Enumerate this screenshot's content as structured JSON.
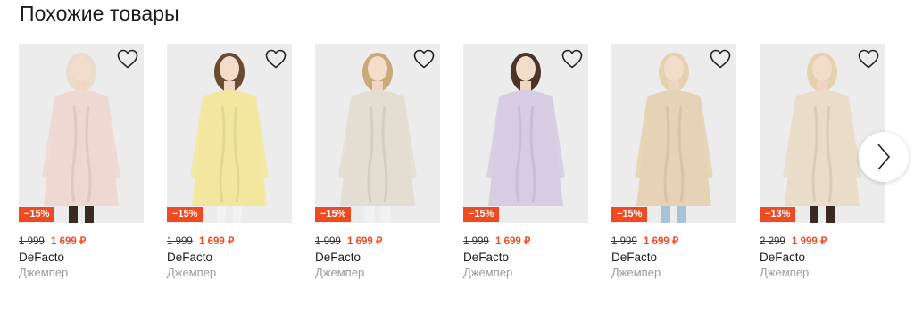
{
  "section": {
    "title": "Похожие товары"
  },
  "products": [
    {
      "brand": "DeFacto",
      "type": "Джемпер",
      "old_price": "1 999",
      "new_price": "1 699 ₽",
      "discount": "−15%",
      "sweater_color": "#efd8d2",
      "bg_color": "#ececec",
      "legs_color": "#3a2a22",
      "hair_color": "#e9dcc8"
    },
    {
      "brand": "DeFacto",
      "type": "Джемпер",
      "old_price": "1 999",
      "new_price": "1 699 ₽",
      "discount": "−15%",
      "sweater_color": "#f3e7a0",
      "bg_color": "#ececec",
      "legs_color": "#f2f2f2",
      "hair_color": "#6b4a32"
    },
    {
      "brand": "DeFacto",
      "type": "Джемпер",
      "old_price": "1 999",
      "new_price": "1 699 ₽",
      "discount": "−15%",
      "sweater_color": "#e4ddd1",
      "bg_color": "#ececec",
      "legs_color": "#f2f2f2",
      "hair_color": "#c9a978"
    },
    {
      "brand": "DeFacto",
      "type": "Джемпер",
      "old_price": "1 999",
      "new_price": "1 699 ₽",
      "discount": "−15%",
      "sweater_color": "#d6cde3",
      "bg_color": "#ececec",
      "legs_color": "#ececec",
      "hair_color": "#4b3326"
    },
    {
      "brand": "DeFacto",
      "type": "Джемпер",
      "old_price": "1 999",
      "new_price": "1 699 ₽",
      "discount": "−15%",
      "sweater_color": "#e6d3b6",
      "bg_color": "#ececec",
      "legs_color": "#a8c2dc",
      "hair_color": "#e4d2ae"
    },
    {
      "brand": "DeFacto",
      "type": "Джемпер",
      "old_price": "2 299",
      "new_price": "1 999 ₽",
      "discount": "−13%",
      "sweater_color": "#e9dcc8",
      "bg_color": "#ececec",
      "legs_color": "#3a2a22",
      "hair_color": "#e4d2ae"
    }
  ],
  "icons": {
    "favorite": "heart-outline-icon",
    "next": "chevron-right-icon"
  },
  "colors": {
    "accent": "#f04a23"
  }
}
